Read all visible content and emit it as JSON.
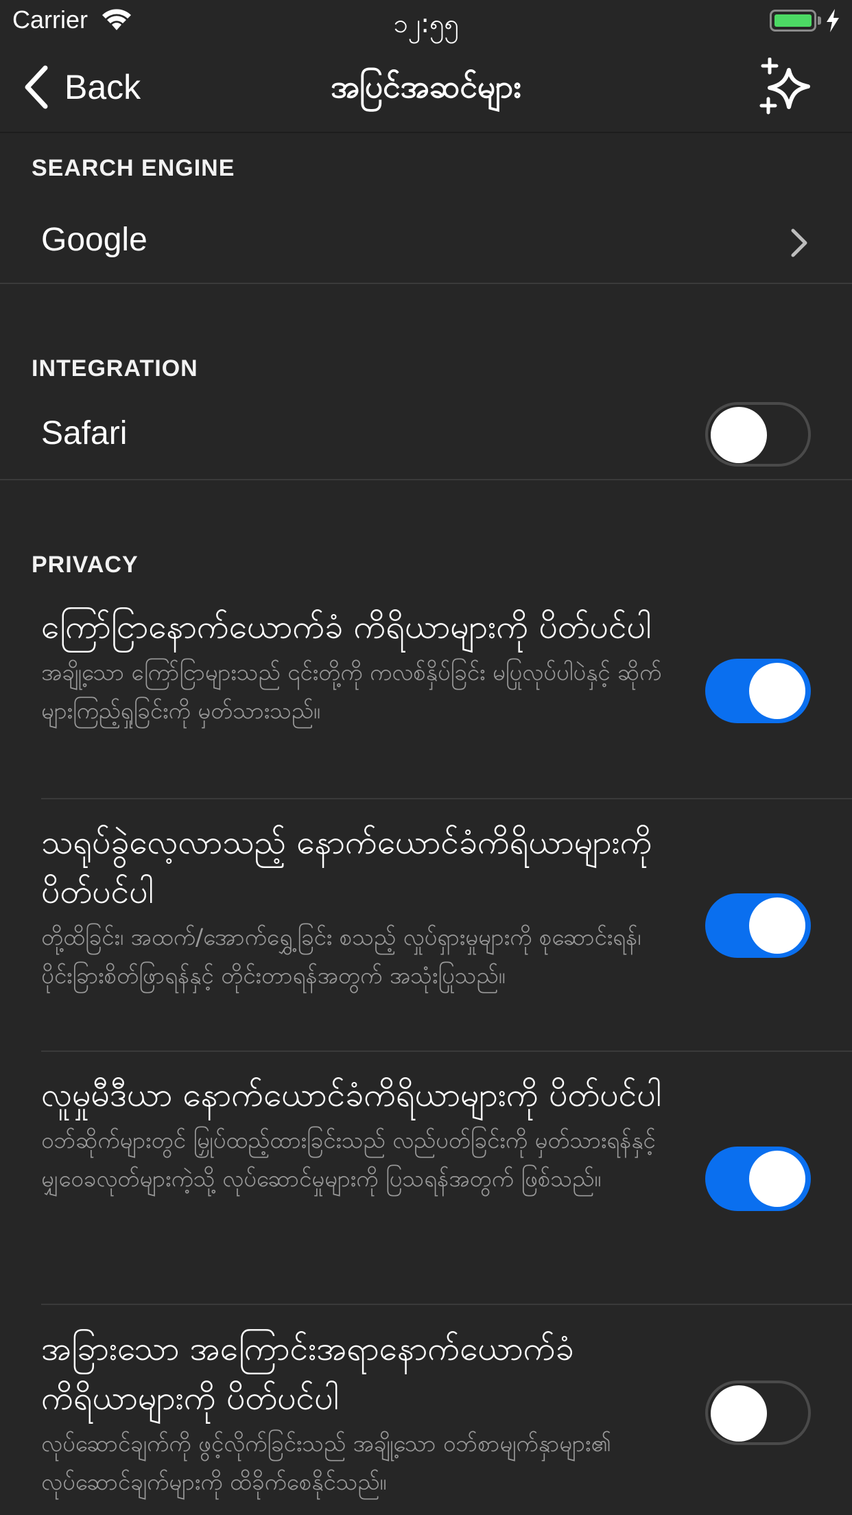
{
  "status_bar": {
    "carrier": "Carrier",
    "time": "၁၂:၅၅",
    "battery_color": "#4cd964"
  },
  "nav": {
    "back_label": "Back",
    "title": "အပြင်အဆင်များ",
    "right_icon": "sparkle-icon"
  },
  "search_engine": {
    "header": "SEARCH ENGINE",
    "value": "Google"
  },
  "integration": {
    "header": "INTEGRATION",
    "label": "Safari",
    "enabled": false
  },
  "privacy": {
    "header": "PRIVACY",
    "items": [
      {
        "title": "ကြော်ငြာနောက်ယောက်ခံ ကိရိယာများကို ပိတ်ပင်ပါ",
        "description": "အချို့သော ကြော်ငြာများသည် ၎င်းတို့ကို ကလစ်နှိပ်ခြင်း မပြုလုပ်ပါပဲနှင့် ဆိုက်များကြည့်ရှုခြင်းကို မှတ်သားသည်။",
        "enabled": true
      },
      {
        "title": "သရုပ်ခွဲလေ့လာသည့် နောက်ယောင်ခံကိရိယာများကို ပိတ်ပင်ပါ",
        "description": "တို့ထိခြင်း၊ အထက်/အောက်ရွှေ့ခြင်း စသည့် လှုပ်ရှားမှုများကို စုဆောင်းရန်၊ ပိုင်းခြားစိတ်ဖြာရန်နှင့် တိုင်းတာရန်အတွက် အသုံးပြုသည်။",
        "enabled": true
      },
      {
        "title": "လူမှုမီဒီယာ နောက်ယောင်ခံကိရိယာများကို ပိတ်ပင်ပါ",
        "description": "ဝဘ်ဆိုက်များတွင် မြှုပ်ထည့်ထားခြင်းသည် လည်ပတ်ခြင်းကို မှတ်သားရန်နှင့် မျှဝေခလုတ်များကဲ့သို့ လုပ်ဆောင်မှုများကို ပြသရန်အတွက် ဖြစ်သည်။",
        "enabled": true
      },
      {
        "title": "အခြားသော အကြောင်းအရာနောက်ယောက်ခံ ကိရိယာများကို ပိတ်ပင်ပါ",
        "description": "လုပ်ဆောင်ချက်ကို ဖွင့်လိုက်ခြင်းသည် အချို့သော ဝဘ်စာမျက်နှာများ၏ လုပ်ဆောင်ချက်များကို ထိခိုက်စေနိုင်သည်။",
        "enabled": false
      }
    ]
  },
  "colors": {
    "background": "#262626",
    "toggle_on": "#0a6fef",
    "secondary_text": "#9b9b9b"
  }
}
